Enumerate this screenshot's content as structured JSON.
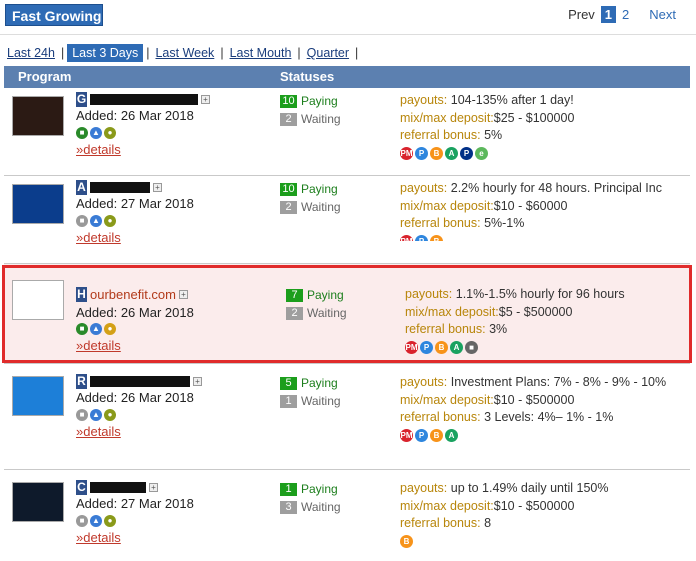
{
  "title": "Fast Growing",
  "pager": {
    "prev": "Prev",
    "current": "1",
    "page2": "2",
    "next": "Next"
  },
  "periods": [
    {
      "label": "Last 24h",
      "active": false
    },
    {
      "label": "Last 3 Days",
      "active": true
    },
    {
      "label": "Last Week",
      "active": false
    },
    {
      "label": "Last Mouth",
      "active": false
    },
    {
      "label": "Quarter",
      "active": false
    }
  ],
  "header": {
    "program": "Program",
    "statuses": "Statuses"
  },
  "details_label": "»details",
  "labels": {
    "paying": "Paying",
    "waiting": "Waiting",
    "payouts": "payouts:",
    "deposit": "mix/max deposit:",
    "referral": "referral bonus:"
  },
  "rows": [
    {
      "letter": "G",
      "name": "",
      "added": "Added: 26 Mar 2018",
      "paying": "10",
      "waiting": "2",
      "payouts": " 104-135% after 1 day!",
      "deposit": "$25 - $100000",
      "referral": " 5%"
    },
    {
      "letter": "A",
      "name": "",
      "added": "Added: 27 Mar 2018",
      "paying": "10",
      "waiting": "2",
      "payouts": " 2.2% hourly for 48 hours. Principal Inc",
      "deposit": "$10 - $60000",
      "referral": " 5%-1%"
    },
    {
      "letter": "H",
      "name": "ourbenefit.com",
      "added": "Added: 26 Mar 2018",
      "paying": "7",
      "waiting": "2",
      "payouts": " 1.1%-1.5% hourly for 96 hours",
      "deposit": "$5 - $500000",
      "referral": " 3%"
    },
    {
      "letter": "R",
      "name": "",
      "added": "Added: 26 Mar 2018",
      "paying": "5",
      "waiting": "1",
      "payouts": " Investment Plans: 7% - 8% - 9% - 10%",
      "deposit": "$10 - $500000",
      "referral": " 3 Levels: 4%– 1% - 1%"
    },
    {
      "letter": "C",
      "name": "",
      "added": "Added: 27 Mar 2018",
      "paying": "1",
      "waiting": "3",
      "payouts": " up to 1.49% daily until 150%",
      "deposit": "$10 - $500000",
      "referral": " 8"
    }
  ],
  "colors": {
    "accent": "#2e6bb5",
    "header": "#5c80b0",
    "paying": "#1c9e1c",
    "highlight": "#e02b2b"
  }
}
